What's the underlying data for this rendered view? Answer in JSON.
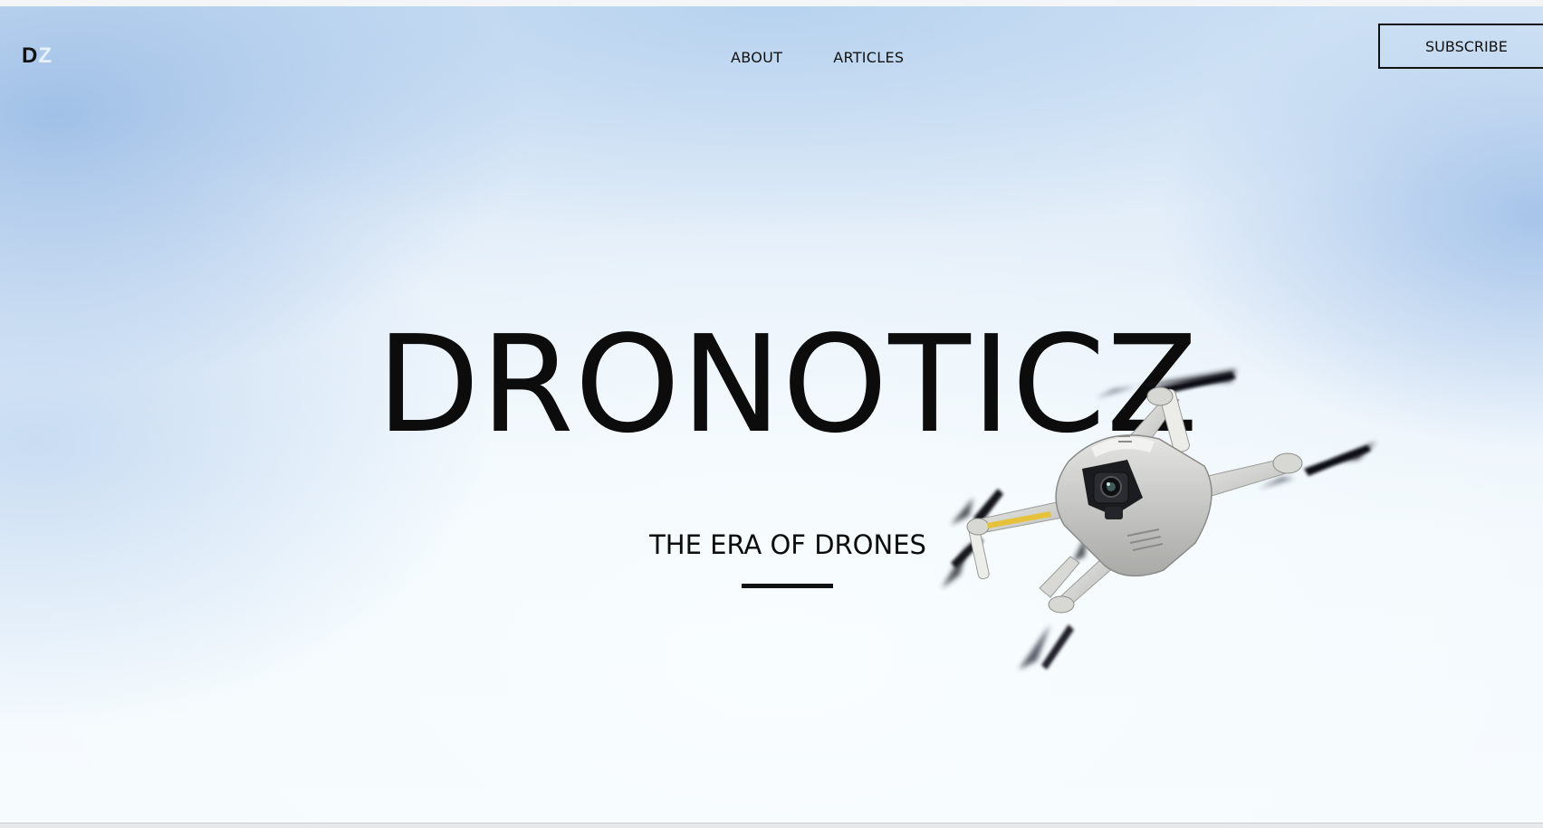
{
  "brand": {
    "logo_letter_1": "D",
    "logo_letter_2": "Z"
  },
  "nav": {
    "items": [
      {
        "label": "ABOUT"
      },
      {
        "label": "ARTICLES"
      }
    ]
  },
  "header": {
    "subscribe_label": "SUBSCRIBE"
  },
  "hero": {
    "title": "DRONOTICZ",
    "subtitle": "THE ERA OF DRONES",
    "image": "drone-photo"
  },
  "colors": {
    "text": "#0c0c0c",
    "sky_light": "#f6fbfe",
    "sky_blue": "#a8c4e8",
    "logo_z": "#e9f1fa"
  }
}
